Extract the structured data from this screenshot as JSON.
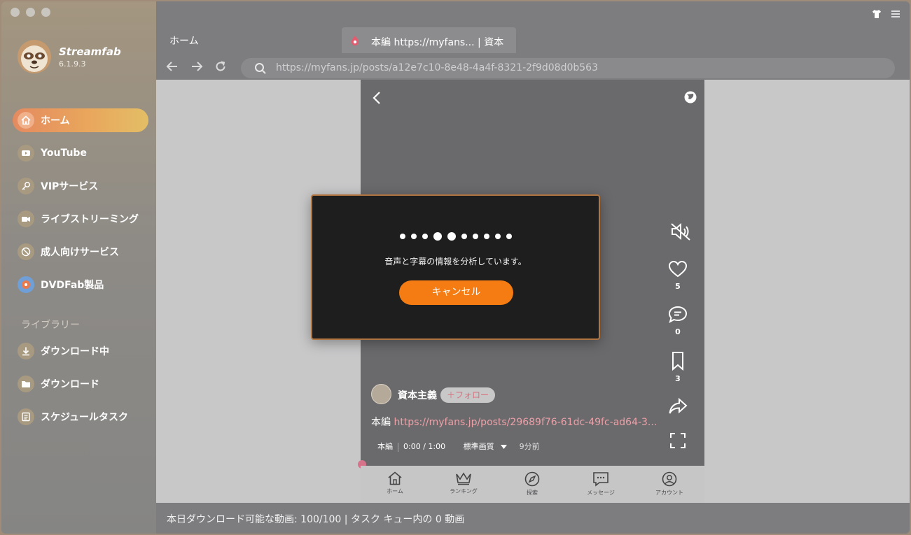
{
  "app": {
    "name": "Streamfab",
    "version": "6.1.9.3"
  },
  "sidebar": {
    "items": [
      {
        "label": "ホーム",
        "icon": "home-icon",
        "active": true
      },
      {
        "label": "YouTube",
        "icon": "youtube-icon"
      },
      {
        "label": "VIPサービス",
        "icon": "key-icon"
      },
      {
        "label": "ライブストリーミング",
        "icon": "camera-icon"
      },
      {
        "label": "成人向けサービス",
        "icon": "adult-icon"
      },
      {
        "label": "DVDFab製品",
        "icon": "dvdfab-icon"
      }
    ],
    "library_title": "ライブラリー",
    "library": [
      {
        "label": "ダウンロード中",
        "icon": "download-icon"
      },
      {
        "label": "ダウンロード",
        "icon": "folder-icon"
      },
      {
        "label": "スケジュールタスク",
        "icon": "schedule-icon"
      }
    ]
  },
  "tabs": {
    "home": "ホーム",
    "active": "本編 https://myfans... | 資本主"
  },
  "browser": {
    "url": "https://myfans.jp/posts/a12e7c10-8e48-4a4f-8321-2f9d08d0b563"
  },
  "post": {
    "author": "資本主義",
    "follow": "＋フォロー",
    "prefix": "本編 ",
    "link": "https://myfans.jp/posts/29689f76-61dc-49fc-ad64-3...",
    "type": "本編",
    "time": "0:00 / 1:00",
    "quality": "標準画質",
    "ago": "9分前",
    "likes": "5",
    "comments": "0",
    "bookmarks": "3"
  },
  "phone_nav": [
    "ホーム",
    "ランキング",
    "探索",
    "メッセージ",
    "アカウント"
  ],
  "modal": {
    "message": "音声と字幕の情報を分析しています。",
    "cancel": "キャンセル"
  },
  "status": "本日ダウンロード可能な動画: 100/100 | タスク キュー内の 0 動画",
  "colors": {
    "accent": "#f47c12",
    "active_nav": "#e9a65c",
    "link": "#eda0a8"
  }
}
